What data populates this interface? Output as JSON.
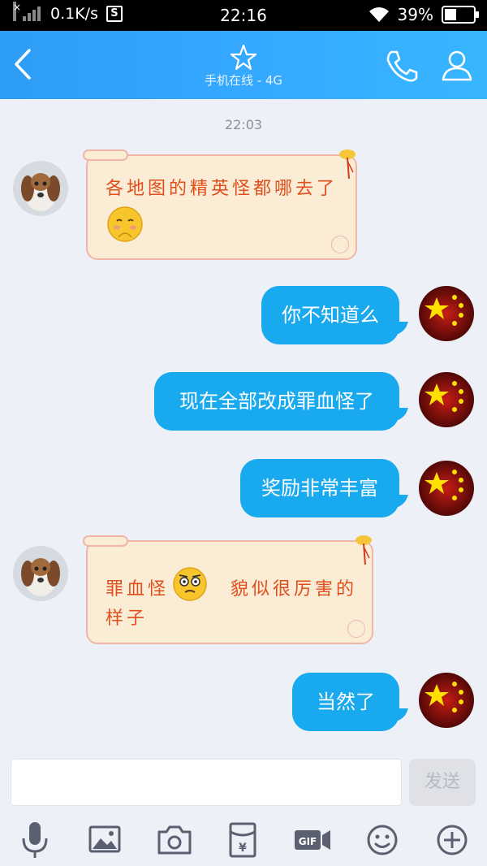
{
  "status_bar": {
    "speed": "0.1K/s",
    "time": "22:16",
    "battery": "39%",
    "battery_level": 0.39
  },
  "header": {
    "title_icon": "star-icon",
    "subtitle": "手机在线 - 4G"
  },
  "chat": {
    "timestamp": "22:03",
    "messages": [
      {
        "direction": "incoming",
        "text": "各地图的精英怪都哪去了",
        "emoji": "shy-face-icon"
      },
      {
        "direction": "outgoing",
        "text": "你不知道么"
      },
      {
        "direction": "outgoing",
        "text": "现在全部改成罪血怪了"
      },
      {
        "direction": "outgoing",
        "text": "奖励非常丰富"
      },
      {
        "direction": "incoming",
        "text_before": "罪血怪",
        "emoji": "confused-face-icon",
        "text_after": "貌似很厉害的",
        "text_line2": "样子"
      },
      {
        "direction": "outgoing",
        "text": "当然了"
      }
    ]
  },
  "input": {
    "placeholder": "",
    "send_label": "发送"
  },
  "toolbar": {
    "icons": [
      "microphone-icon",
      "image-icon",
      "camera-icon",
      "red-packet-icon",
      "gif-icon",
      "emoji-icon",
      "plus-icon"
    ]
  },
  "colors": {
    "header_blue": "#35a8ff",
    "bubble_blue": "#19a9ee",
    "paper_bg": "#fbecd6",
    "paper_text": "#e04e1c",
    "background": "#eef0f7"
  }
}
